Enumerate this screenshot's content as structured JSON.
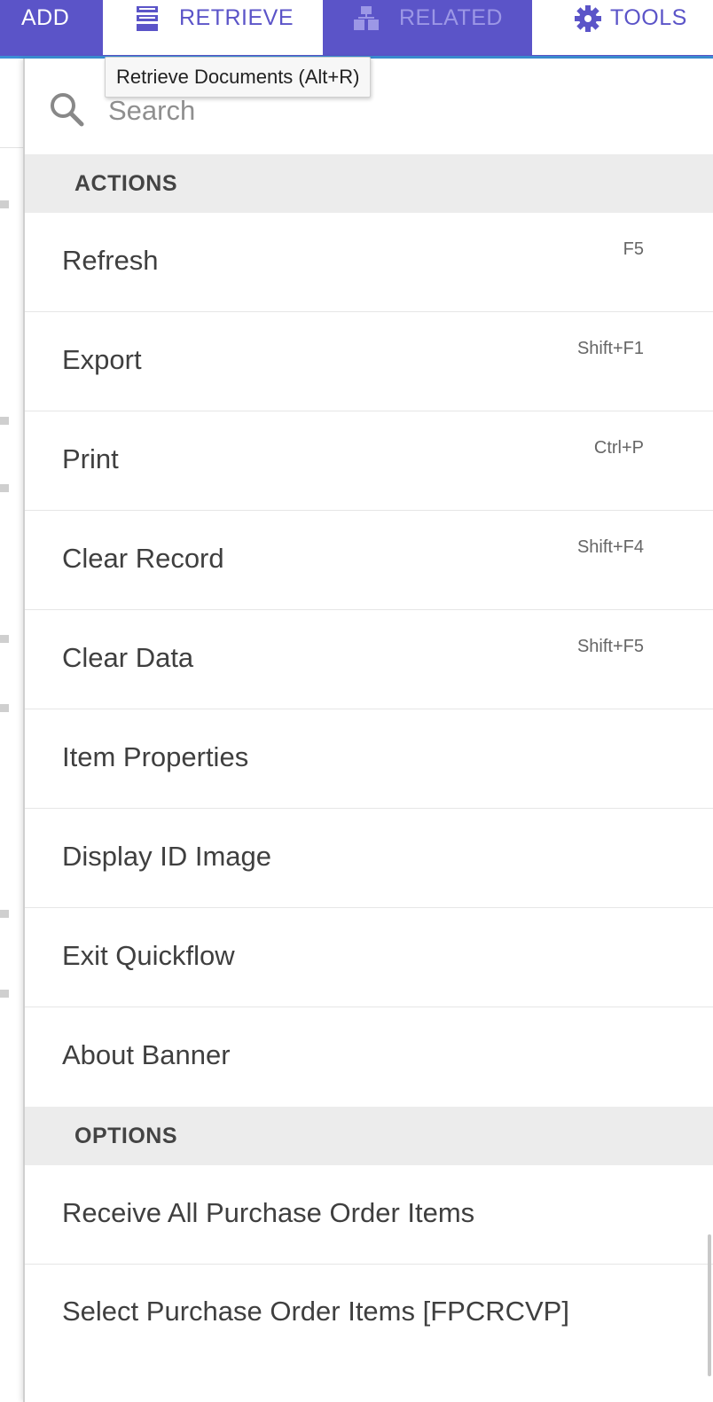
{
  "toolbar": {
    "add_label": "ADD",
    "retrieve_label": "RETRIEVE",
    "related_label": "RELATED",
    "tools_label": "TOOLS",
    "retrieve_icon": "document-stack-icon",
    "related_icon": "related-records-icon",
    "tools_icon": "gear-icon"
  },
  "tooltip": {
    "text": "Retrieve Documents (Alt+R)"
  },
  "search": {
    "placeholder": "Search",
    "icon": "search-icon"
  },
  "sections": {
    "actions": {
      "title": "ACTIONS",
      "items": [
        {
          "label": "Refresh",
          "shortcut": "F5"
        },
        {
          "label": "Export",
          "shortcut": "Shift+F1"
        },
        {
          "label": "Print",
          "shortcut": "Ctrl+P"
        },
        {
          "label": "Clear Record",
          "shortcut": "Shift+F4"
        },
        {
          "label": "Clear Data",
          "shortcut": "Shift+F5"
        },
        {
          "label": "Item Properties",
          "shortcut": ""
        },
        {
          "label": "Display ID Image",
          "shortcut": ""
        },
        {
          "label": "Exit Quickflow",
          "shortcut": ""
        },
        {
          "label": "About Banner",
          "shortcut": ""
        }
      ]
    },
    "options": {
      "title": "OPTIONS",
      "items": [
        {
          "label": "Receive All Purchase Order Items"
        },
        {
          "label": "Select Purchase Order Items [FPCRCVP]"
        }
      ]
    }
  },
  "colors": {
    "toolbar_bg": "#5b54c8",
    "toolbar_underline": "#3c8fd6",
    "section_bg": "#ececec"
  }
}
